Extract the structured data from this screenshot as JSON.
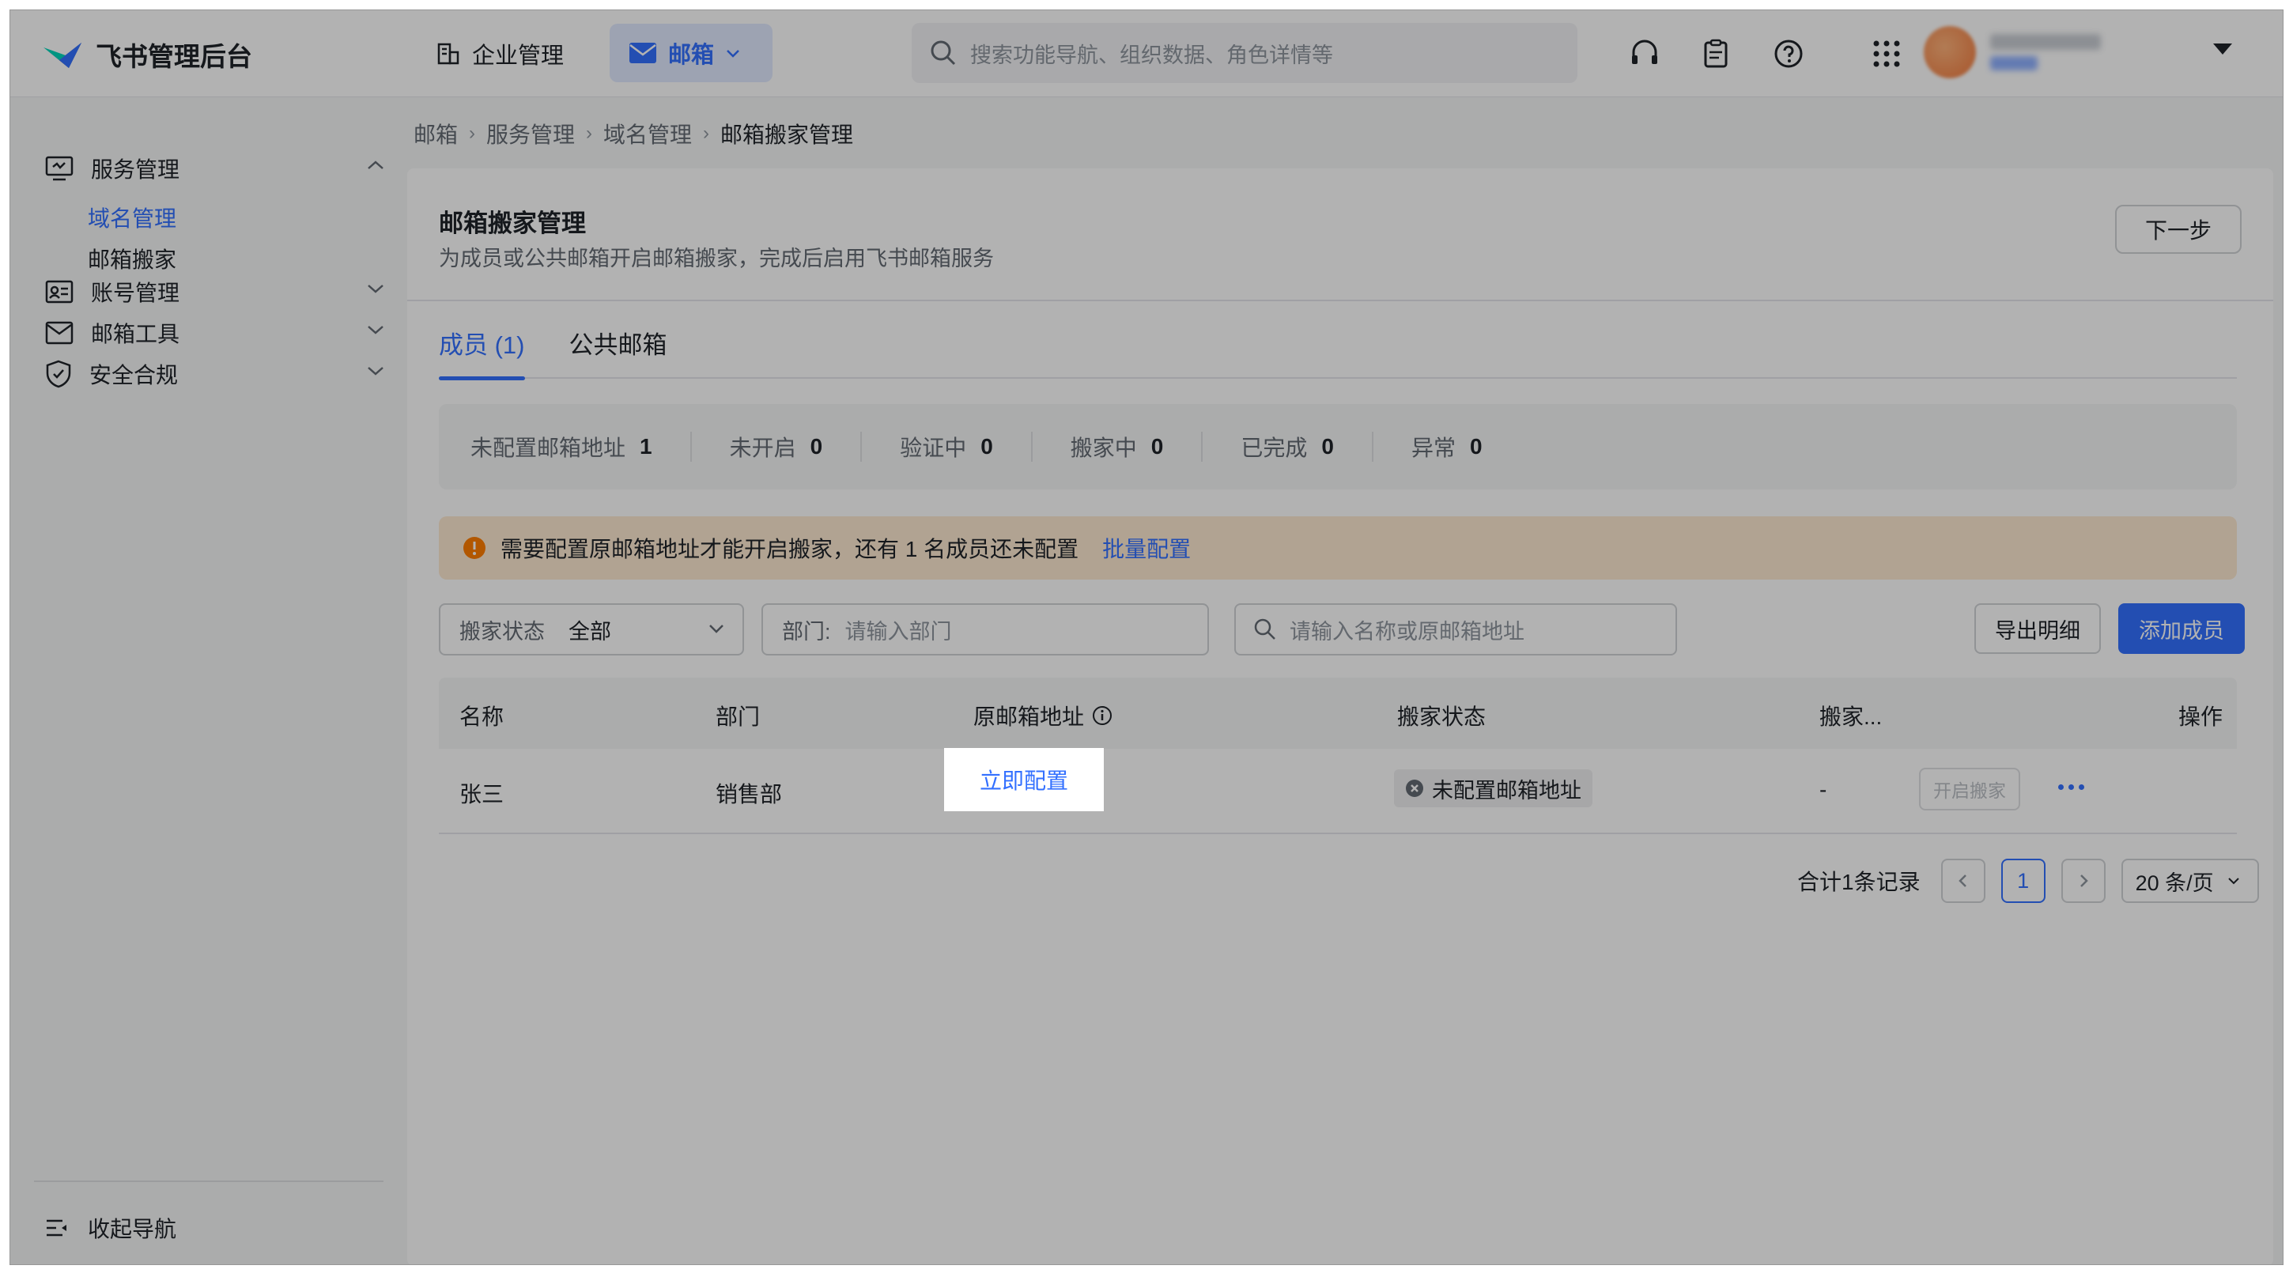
{
  "app": {
    "title": "飞书管理后台"
  },
  "topnav": {
    "org_label": "企业管理",
    "mail_label": "邮箱",
    "search_placeholder": "搜索功能导航、组织数据、角色详情等"
  },
  "sidebar": {
    "groups": [
      {
        "label": "服务管理",
        "expanded": true,
        "icon": "monitor-icon"
      },
      {
        "label": "账号管理",
        "expanded": false,
        "icon": "id-card-icon"
      },
      {
        "label": "邮箱工具",
        "expanded": false,
        "icon": "mail-icon"
      },
      {
        "label": "安全合规",
        "expanded": false,
        "icon": "shield-icon"
      }
    ],
    "sub_items": [
      {
        "label": "域名管理",
        "active": true
      },
      {
        "label": "邮箱搬家",
        "active": false
      }
    ],
    "collapse_label": "收起导航"
  },
  "breadcrumb": [
    "邮箱",
    "服务管理",
    "域名管理",
    "邮箱搬家管理"
  ],
  "page": {
    "title": "邮箱搬家管理",
    "description": "为成员或公共邮箱开启邮箱搬家，完成后启用飞书邮箱服务",
    "next_label": "下一步"
  },
  "tabs": [
    {
      "label": "成员 (1)",
      "active": true
    },
    {
      "label": "公共邮箱",
      "active": false
    }
  ],
  "stats": [
    {
      "label": "未配置邮箱地址",
      "value": "1"
    },
    {
      "label": "未开启",
      "value": "0"
    },
    {
      "label": "验证中",
      "value": "0"
    },
    {
      "label": "搬家中",
      "value": "0"
    },
    {
      "label": "已完成",
      "value": "0"
    },
    {
      "label": "异常",
      "value": "0"
    }
  ],
  "alert": {
    "text": "需要配置原邮箱地址才能开启搬家，还有 1 名成员还未配置",
    "link": "批量配置"
  },
  "filters": {
    "status_key": "搬家状态",
    "status_value": "全部",
    "dept_key": "部门:",
    "dept_placeholder": "请输入部门",
    "search_placeholder": "请输入名称或原邮箱地址",
    "export_label": "导出明细",
    "add_label": "添加成员"
  },
  "table": {
    "headers": [
      "名称",
      "部门",
      "原邮箱地址",
      "搬家状态",
      "搬家...",
      "操作"
    ],
    "rows": [
      {
        "name": "张三",
        "dept": "销售部",
        "config": "立即配置",
        "status": "未配置邮箱地址",
        "progress": "-",
        "start": "开启搬家"
      }
    ]
  },
  "pagination": {
    "total": "合计1条记录",
    "current": "1",
    "page_size": "20 条/页"
  },
  "colors": {
    "accent": "#3370ff",
    "warning_bg": "#feead2",
    "warning_icon": "#ff7d00"
  }
}
